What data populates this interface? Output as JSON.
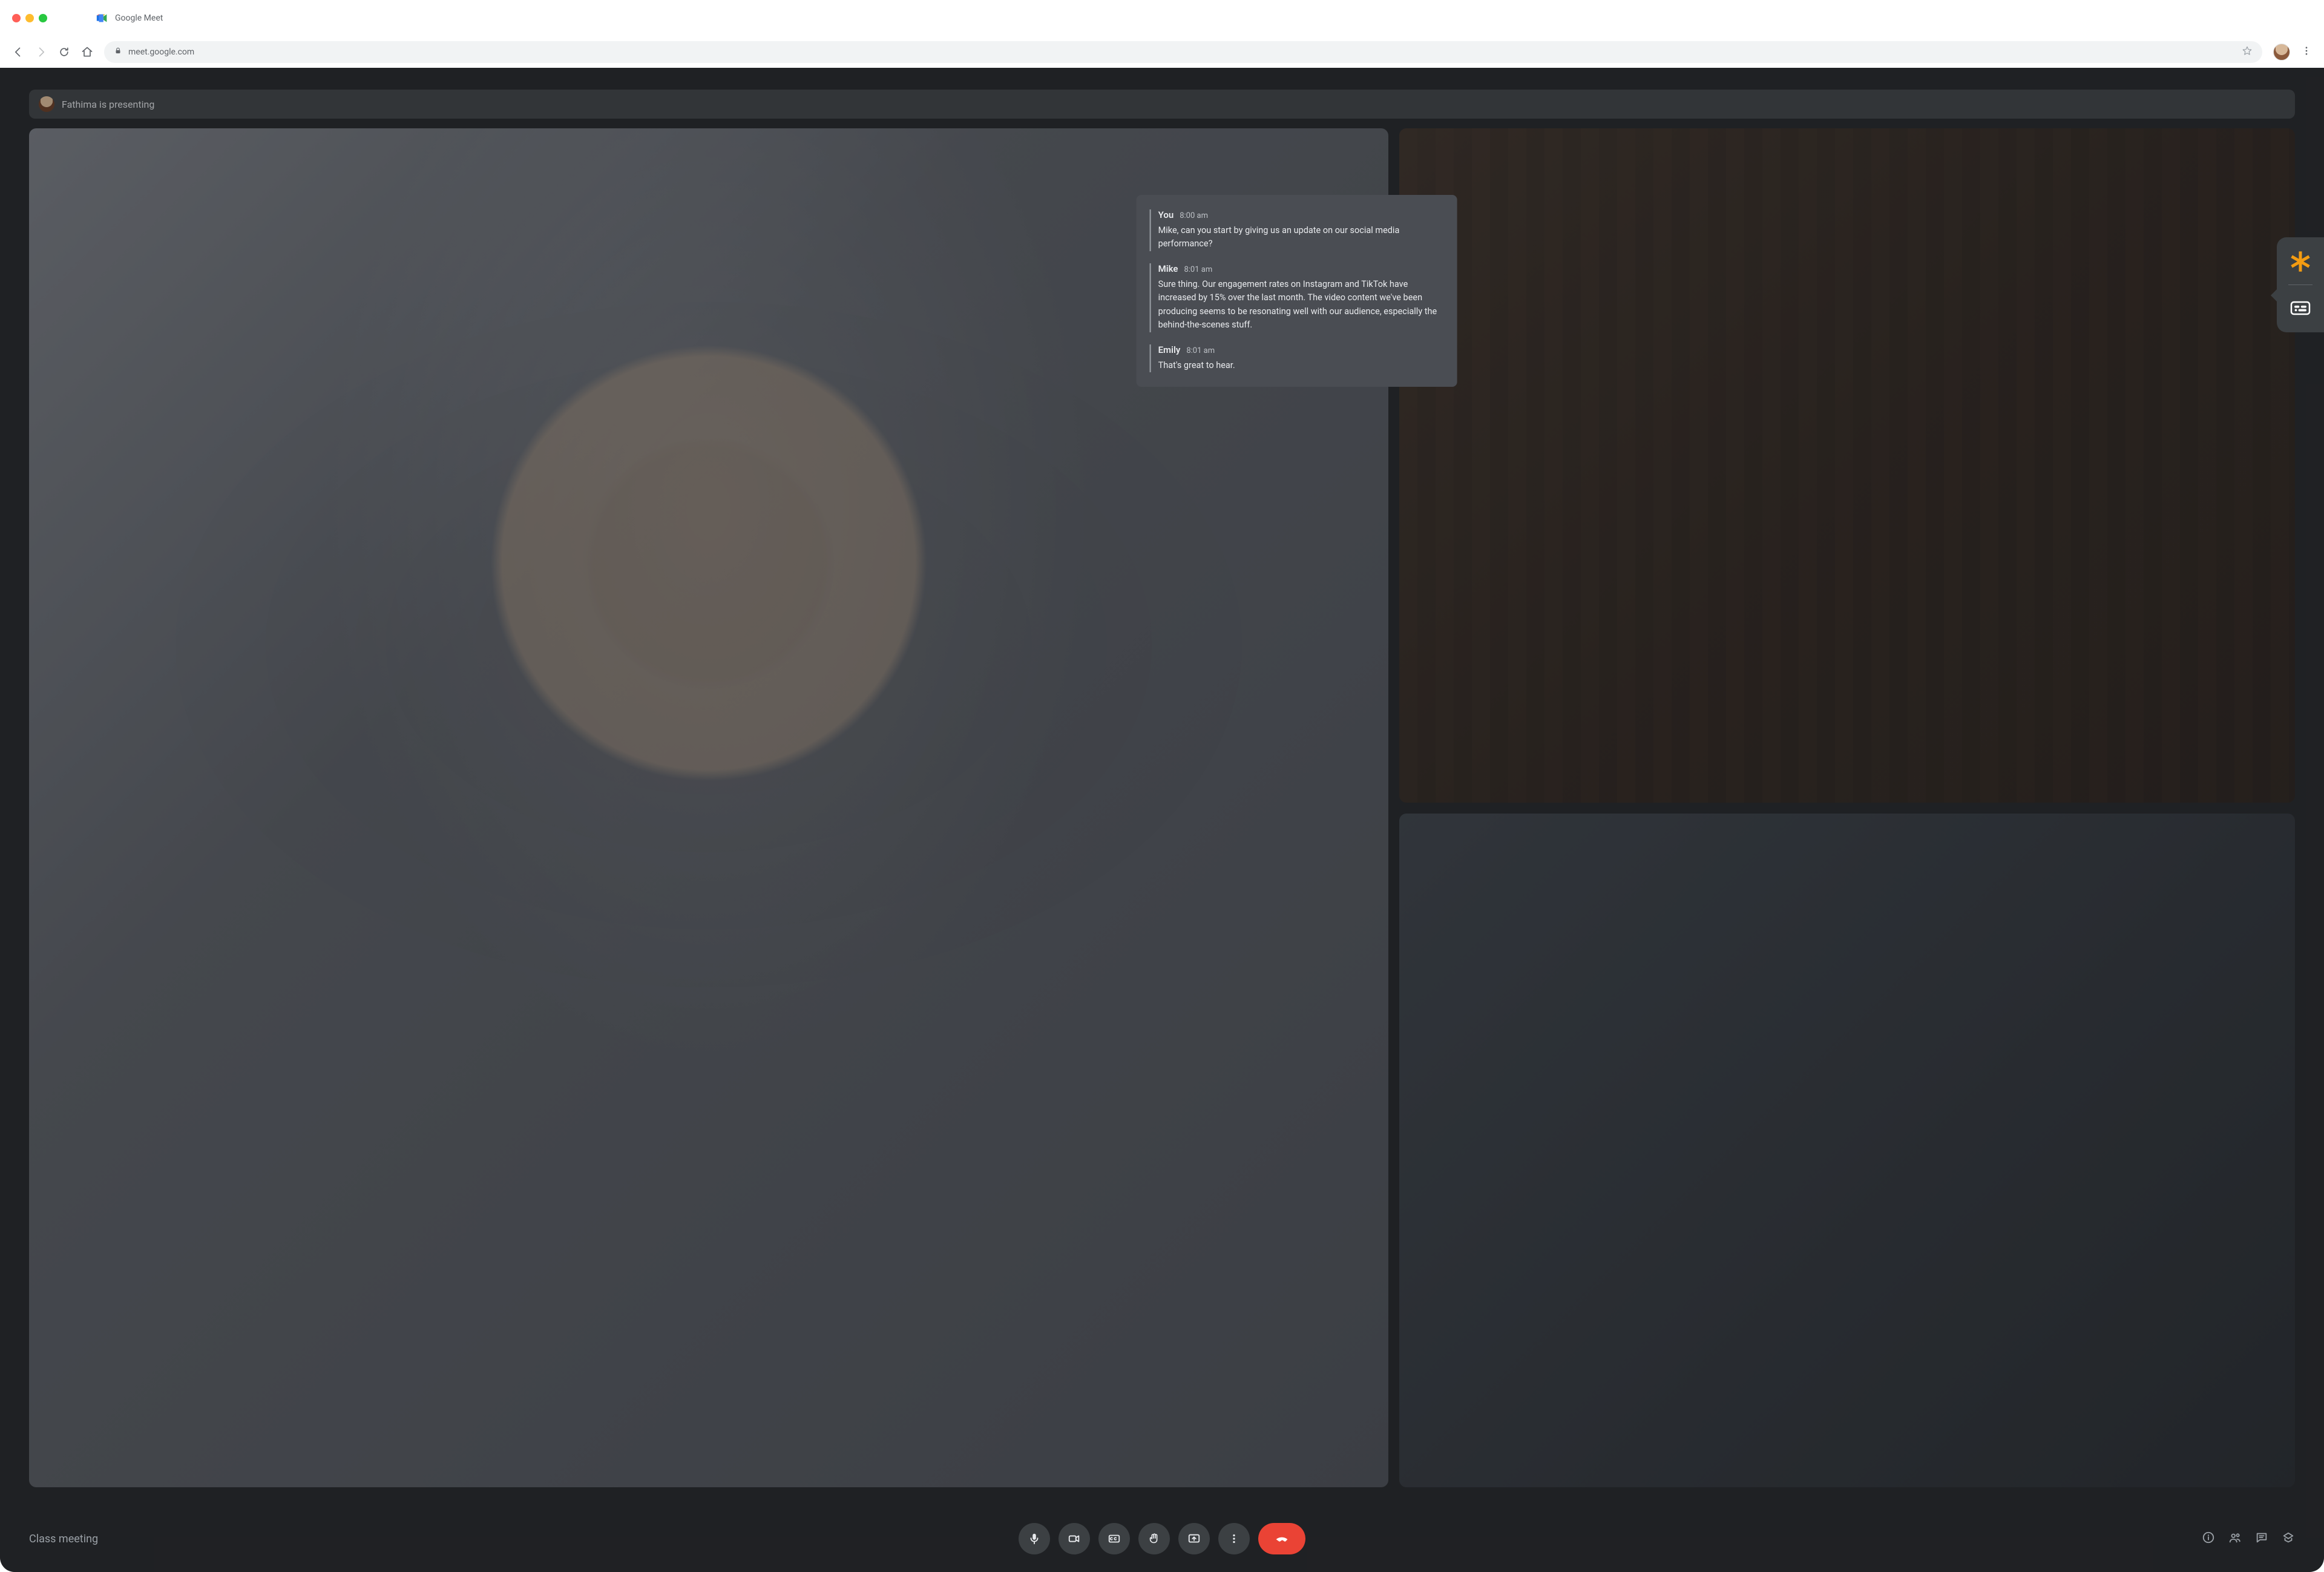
{
  "browser": {
    "tab_title": "Google Meet",
    "url": "meet.google.com"
  },
  "banner": {
    "text": "Fathima is presenting"
  },
  "meeting": {
    "name": "Class meeting"
  },
  "chat": {
    "messages": [
      {
        "author": "You",
        "time": "8:00 am",
        "body": "Mike, can you start by giving us an update on our social media performance?"
      },
      {
        "author": "Mike",
        "time": "8:01 am",
        "body": "Sure thing. Our engagement rates on Instagram and TikTok have increased by 15% over the last month. The video content we've been producing seems to be resonating well with our audience, especially the behind-the-scenes stuff."
      },
      {
        "author": "Emily",
        "time": "8:01 am",
        "body": "That's great to hear."
      }
    ]
  }
}
